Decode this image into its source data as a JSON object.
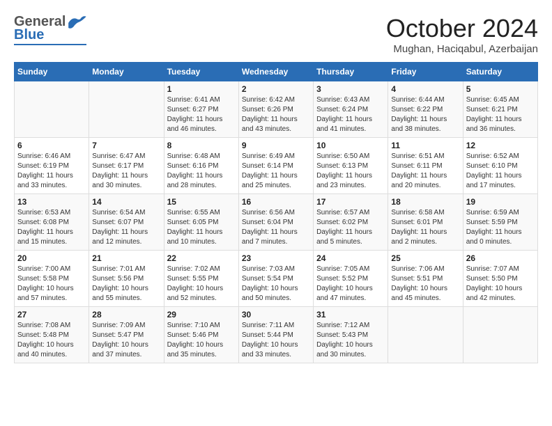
{
  "header": {
    "logo": {
      "line1": "General",
      "line2": "Blue"
    },
    "title": "October 2024",
    "subtitle": "Mughan, Haciqabul, Azerbaijan"
  },
  "weekdays": [
    "Sunday",
    "Monday",
    "Tuesday",
    "Wednesday",
    "Thursday",
    "Friday",
    "Saturday"
  ],
  "weeks": [
    [
      {
        "day": "",
        "info": ""
      },
      {
        "day": "",
        "info": ""
      },
      {
        "day": "1",
        "info": "Sunrise: 6:41 AM\nSunset: 6:27 PM\nDaylight: 11 hours and 46 minutes."
      },
      {
        "day": "2",
        "info": "Sunrise: 6:42 AM\nSunset: 6:26 PM\nDaylight: 11 hours and 43 minutes."
      },
      {
        "day": "3",
        "info": "Sunrise: 6:43 AM\nSunset: 6:24 PM\nDaylight: 11 hours and 41 minutes."
      },
      {
        "day": "4",
        "info": "Sunrise: 6:44 AM\nSunset: 6:22 PM\nDaylight: 11 hours and 38 minutes."
      },
      {
        "day": "5",
        "info": "Sunrise: 6:45 AM\nSunset: 6:21 PM\nDaylight: 11 hours and 36 minutes."
      }
    ],
    [
      {
        "day": "6",
        "info": "Sunrise: 6:46 AM\nSunset: 6:19 PM\nDaylight: 11 hours and 33 minutes."
      },
      {
        "day": "7",
        "info": "Sunrise: 6:47 AM\nSunset: 6:17 PM\nDaylight: 11 hours and 30 minutes."
      },
      {
        "day": "8",
        "info": "Sunrise: 6:48 AM\nSunset: 6:16 PM\nDaylight: 11 hours and 28 minutes."
      },
      {
        "day": "9",
        "info": "Sunrise: 6:49 AM\nSunset: 6:14 PM\nDaylight: 11 hours and 25 minutes."
      },
      {
        "day": "10",
        "info": "Sunrise: 6:50 AM\nSunset: 6:13 PM\nDaylight: 11 hours and 23 minutes."
      },
      {
        "day": "11",
        "info": "Sunrise: 6:51 AM\nSunset: 6:11 PM\nDaylight: 11 hours and 20 minutes."
      },
      {
        "day": "12",
        "info": "Sunrise: 6:52 AM\nSunset: 6:10 PM\nDaylight: 11 hours and 17 minutes."
      }
    ],
    [
      {
        "day": "13",
        "info": "Sunrise: 6:53 AM\nSunset: 6:08 PM\nDaylight: 11 hours and 15 minutes."
      },
      {
        "day": "14",
        "info": "Sunrise: 6:54 AM\nSunset: 6:07 PM\nDaylight: 11 hours and 12 minutes."
      },
      {
        "day": "15",
        "info": "Sunrise: 6:55 AM\nSunset: 6:05 PM\nDaylight: 11 hours and 10 minutes."
      },
      {
        "day": "16",
        "info": "Sunrise: 6:56 AM\nSunset: 6:04 PM\nDaylight: 11 hours and 7 minutes."
      },
      {
        "day": "17",
        "info": "Sunrise: 6:57 AM\nSunset: 6:02 PM\nDaylight: 11 hours and 5 minutes."
      },
      {
        "day": "18",
        "info": "Sunrise: 6:58 AM\nSunset: 6:01 PM\nDaylight: 11 hours and 2 minutes."
      },
      {
        "day": "19",
        "info": "Sunrise: 6:59 AM\nSunset: 5:59 PM\nDaylight: 11 hours and 0 minutes."
      }
    ],
    [
      {
        "day": "20",
        "info": "Sunrise: 7:00 AM\nSunset: 5:58 PM\nDaylight: 10 hours and 57 minutes."
      },
      {
        "day": "21",
        "info": "Sunrise: 7:01 AM\nSunset: 5:56 PM\nDaylight: 10 hours and 55 minutes."
      },
      {
        "day": "22",
        "info": "Sunrise: 7:02 AM\nSunset: 5:55 PM\nDaylight: 10 hours and 52 minutes."
      },
      {
        "day": "23",
        "info": "Sunrise: 7:03 AM\nSunset: 5:54 PM\nDaylight: 10 hours and 50 minutes."
      },
      {
        "day": "24",
        "info": "Sunrise: 7:05 AM\nSunset: 5:52 PM\nDaylight: 10 hours and 47 minutes."
      },
      {
        "day": "25",
        "info": "Sunrise: 7:06 AM\nSunset: 5:51 PM\nDaylight: 10 hours and 45 minutes."
      },
      {
        "day": "26",
        "info": "Sunrise: 7:07 AM\nSunset: 5:50 PM\nDaylight: 10 hours and 42 minutes."
      }
    ],
    [
      {
        "day": "27",
        "info": "Sunrise: 7:08 AM\nSunset: 5:48 PM\nDaylight: 10 hours and 40 minutes."
      },
      {
        "day": "28",
        "info": "Sunrise: 7:09 AM\nSunset: 5:47 PM\nDaylight: 10 hours and 37 minutes."
      },
      {
        "day": "29",
        "info": "Sunrise: 7:10 AM\nSunset: 5:46 PM\nDaylight: 10 hours and 35 minutes."
      },
      {
        "day": "30",
        "info": "Sunrise: 7:11 AM\nSunset: 5:44 PM\nDaylight: 10 hours and 33 minutes."
      },
      {
        "day": "31",
        "info": "Sunrise: 7:12 AM\nSunset: 5:43 PM\nDaylight: 10 hours and 30 minutes."
      },
      {
        "day": "",
        "info": ""
      },
      {
        "day": "",
        "info": ""
      }
    ]
  ]
}
